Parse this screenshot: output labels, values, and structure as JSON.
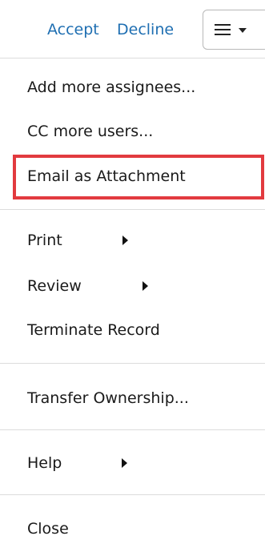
{
  "toolbar": {
    "accept_label": "Accept",
    "decline_label": "Decline",
    "menu_button_icon": "hamburger-menu-icon"
  },
  "menu": {
    "items": [
      {
        "label": "Add more assignees..."
      },
      {
        "label": "CC more users..."
      },
      {
        "label": "Email as Attachment"
      },
      {
        "label": "Print",
        "has_submenu": true
      },
      {
        "label": "Review",
        "has_submenu": true
      },
      {
        "label": "Terminate Record"
      },
      {
        "label": "Transfer Ownership..."
      },
      {
        "label": "Help",
        "has_submenu": true
      },
      {
        "label": "Close"
      }
    ]
  },
  "colors": {
    "link": "#1f6fb2",
    "highlight_border": "#e23a3f",
    "divider": "#dcdcdc"
  }
}
